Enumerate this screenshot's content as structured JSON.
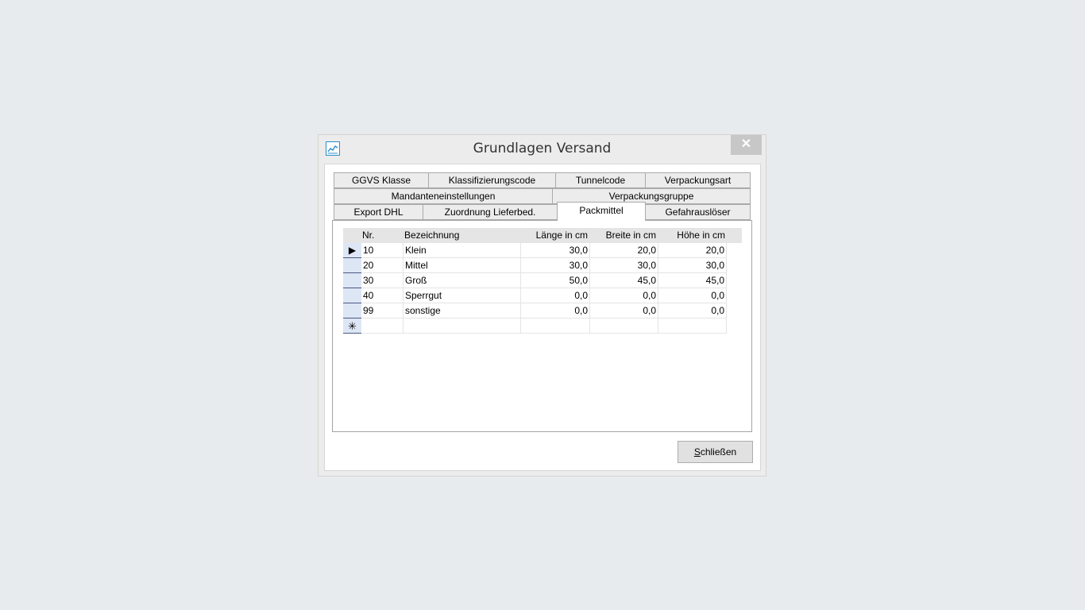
{
  "window": {
    "title": "Grundlagen Versand",
    "close_glyph": "✕",
    "icon": "chart-icon"
  },
  "tabs": {
    "row1": [
      "GGVS Klasse",
      "Klassifizierungscode",
      "Tunnelcode",
      "Verpackungsart"
    ],
    "row2": [
      "Mandanteneinstellungen",
      "Verpackungsgruppe"
    ],
    "row3": [
      "Export DHL",
      "Zuordnung Lieferbed.",
      "Packmittel",
      "Gefahrauslöser"
    ],
    "active": "Packmittel"
  },
  "table": {
    "columns": [
      "Nr.",
      "Bezeichnung",
      "Länge in cm",
      "Breite in cm",
      "Höhe in cm"
    ],
    "rows": [
      [
        "10",
        "Klein",
        "30,0",
        "20,0",
        "20,0"
      ],
      [
        "20",
        "Mittel",
        "30,0",
        "30,0",
        "30,0"
      ],
      [
        "30",
        "Groß",
        "50,0",
        "45,0",
        "45,0"
      ],
      [
        "40",
        "Sperrgut",
        "0,0",
        "0,0",
        "0,0"
      ],
      [
        "99",
        "sonstige",
        "0,0",
        "0,0",
        "0,0"
      ]
    ],
    "current_row_marker": "▶",
    "new_row_marker": "✳"
  },
  "footer": {
    "close_button_mnemonic": "S",
    "close_button_rest": "chließen"
  }
}
